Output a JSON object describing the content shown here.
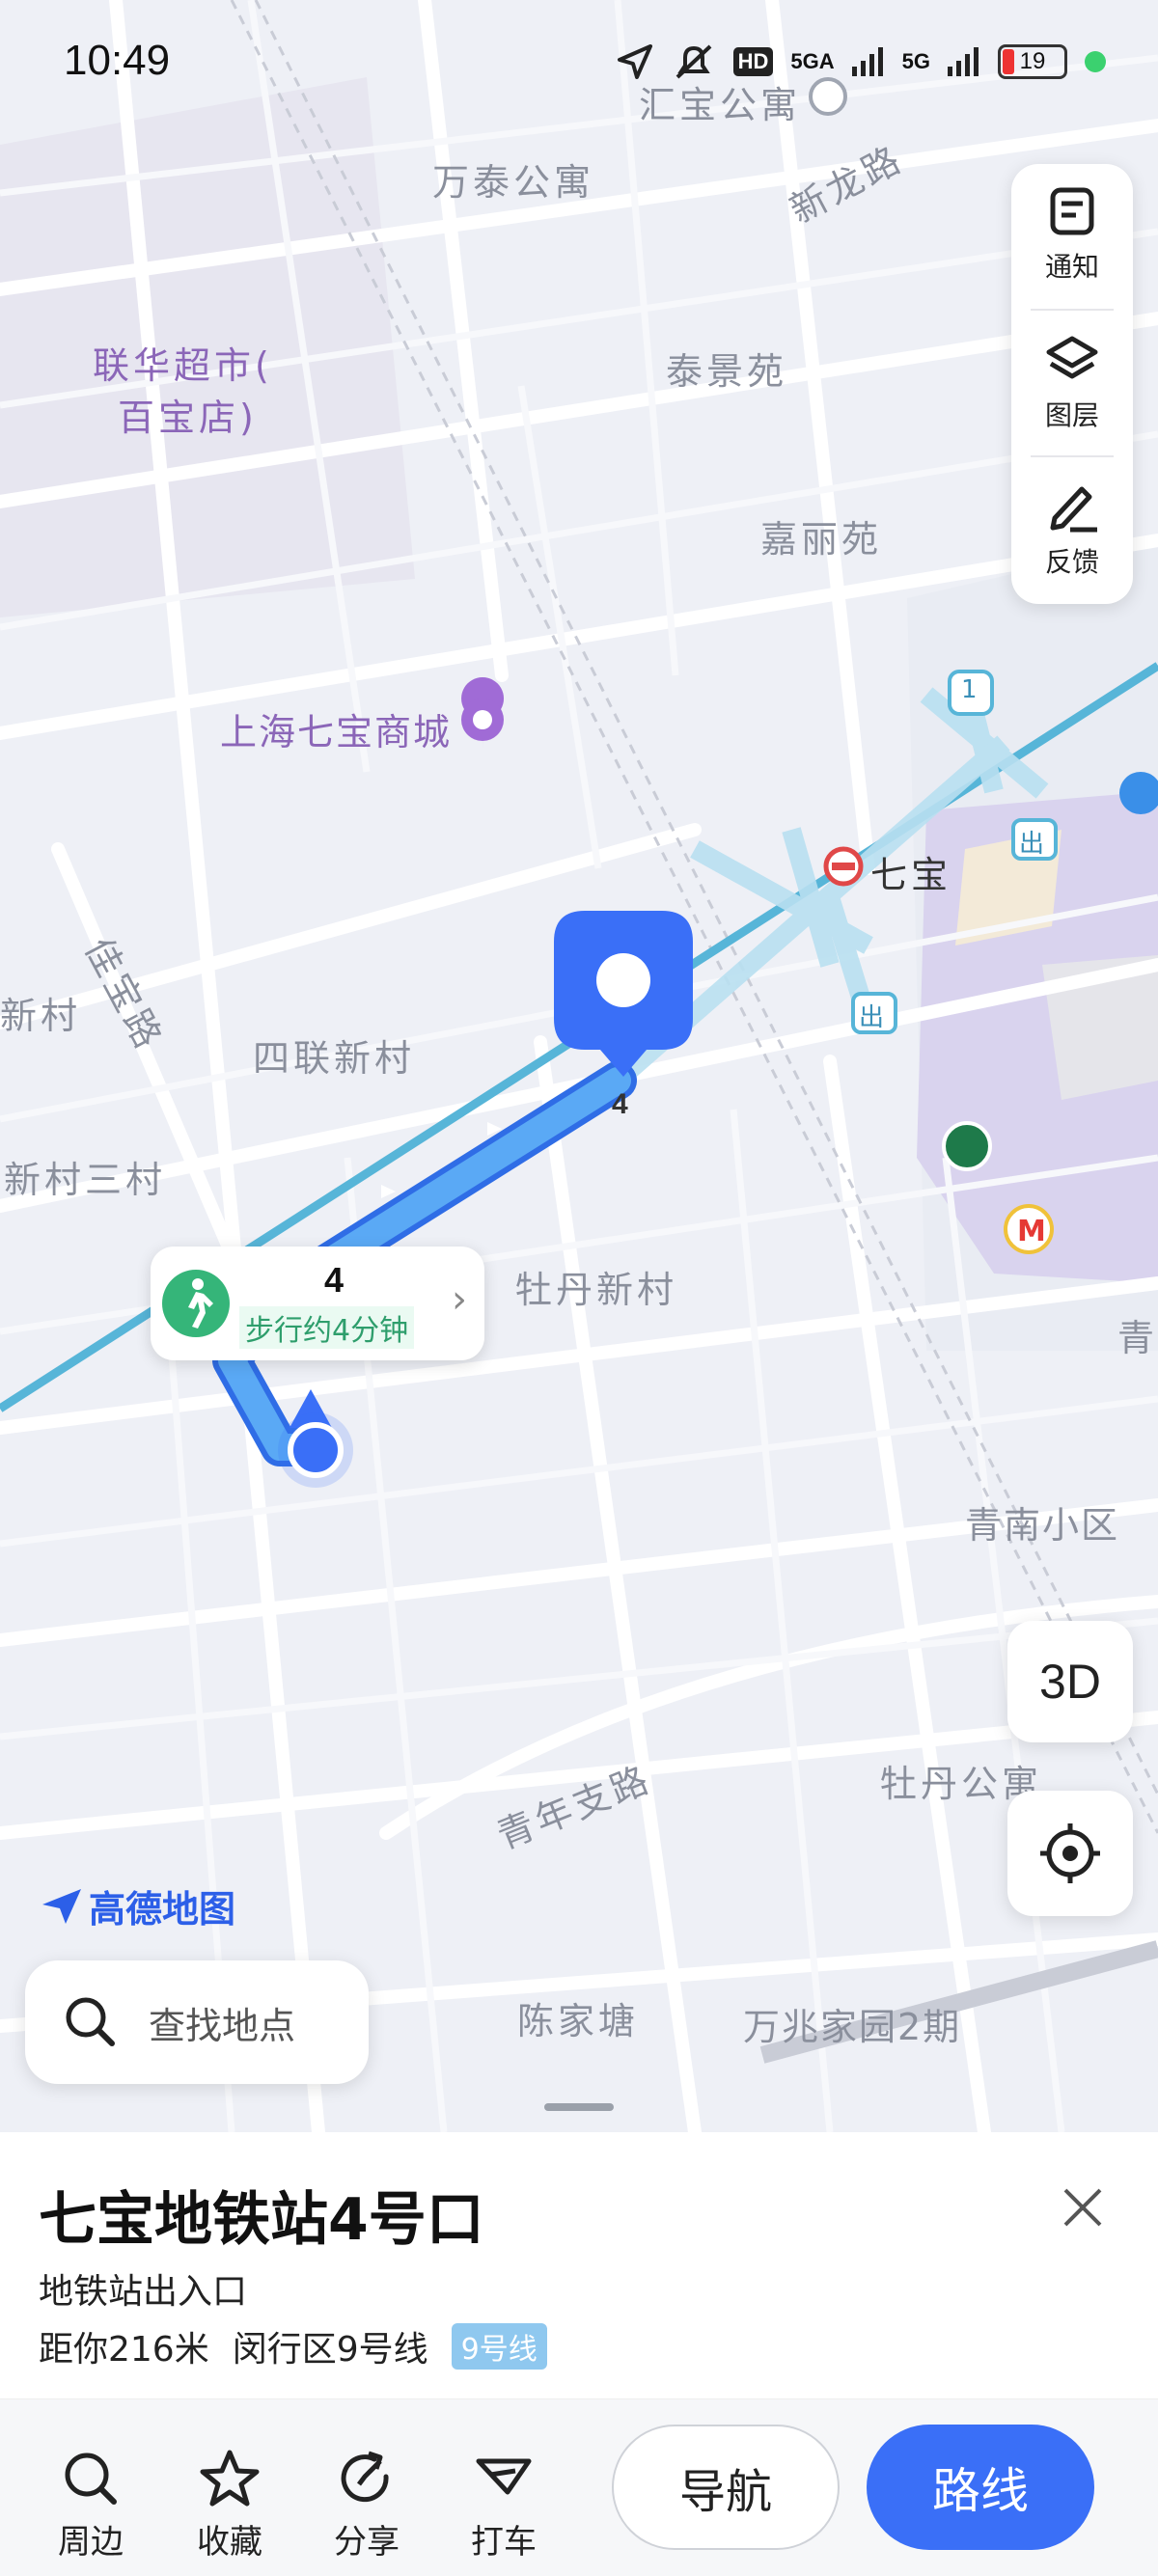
{
  "status_bar": {
    "time": "10:49",
    "hd_label": "HD",
    "signal_1": "5GA",
    "signal_2": "5G",
    "battery": "19",
    "battery_level_percent": 19
  },
  "map": {
    "labels": {
      "huibao": "汇宝公寓",
      "wantai": "万泰公寓",
      "xinlonglu": "新龙路",
      "lianhua_1": "联华超市(",
      "lianhua_2": "百宝店)",
      "taijing": "泰景苑",
      "jiali": "嘉丽苑",
      "shopping": "上海七宝商城",
      "qibao_station": "七宝",
      "jiabaolu": "佳宝路",
      "xincun_edge": "新村",
      "silian": "四联新村",
      "xincun_san": "新村三村",
      "mudan": "牡丹新村",
      "qingnan": "青南小区",
      "qing_edge": "青",
      "qingnian": "青年支路",
      "mudan_apt": "牡丹公寓",
      "chenjiatang": "陈家塘",
      "wanzhao": "万兆家园2期",
      "line_badge": "1",
      "exit_1": "出",
      "exit_2": "出"
    },
    "pin_number": "4"
  },
  "tools": {
    "notice": "通知",
    "layers": "图层",
    "feedback": "反馈"
  },
  "btn_3d": "3D",
  "callout": {
    "number": "4",
    "duration": "步行约4分钟"
  },
  "logo_text": "高德地图",
  "search": {
    "placeholder": "查找地点"
  },
  "sheet": {
    "title": "七宝地铁站4号口",
    "subtitle": "地铁站出入口",
    "distance": "距你216米",
    "district_line": "闵行区9号线",
    "line_badge": "9号线",
    "actions": {
      "nearby": "周边",
      "favorite": "收藏",
      "share": "分享",
      "taxi": "打车"
    },
    "navigate": "导航",
    "route": "路线"
  },
  "colors": {
    "accent": "#3a6ff7",
    "walk_green": "#35b579",
    "metro_line": "#57b5d8",
    "map_bg": "#eef0f6"
  }
}
